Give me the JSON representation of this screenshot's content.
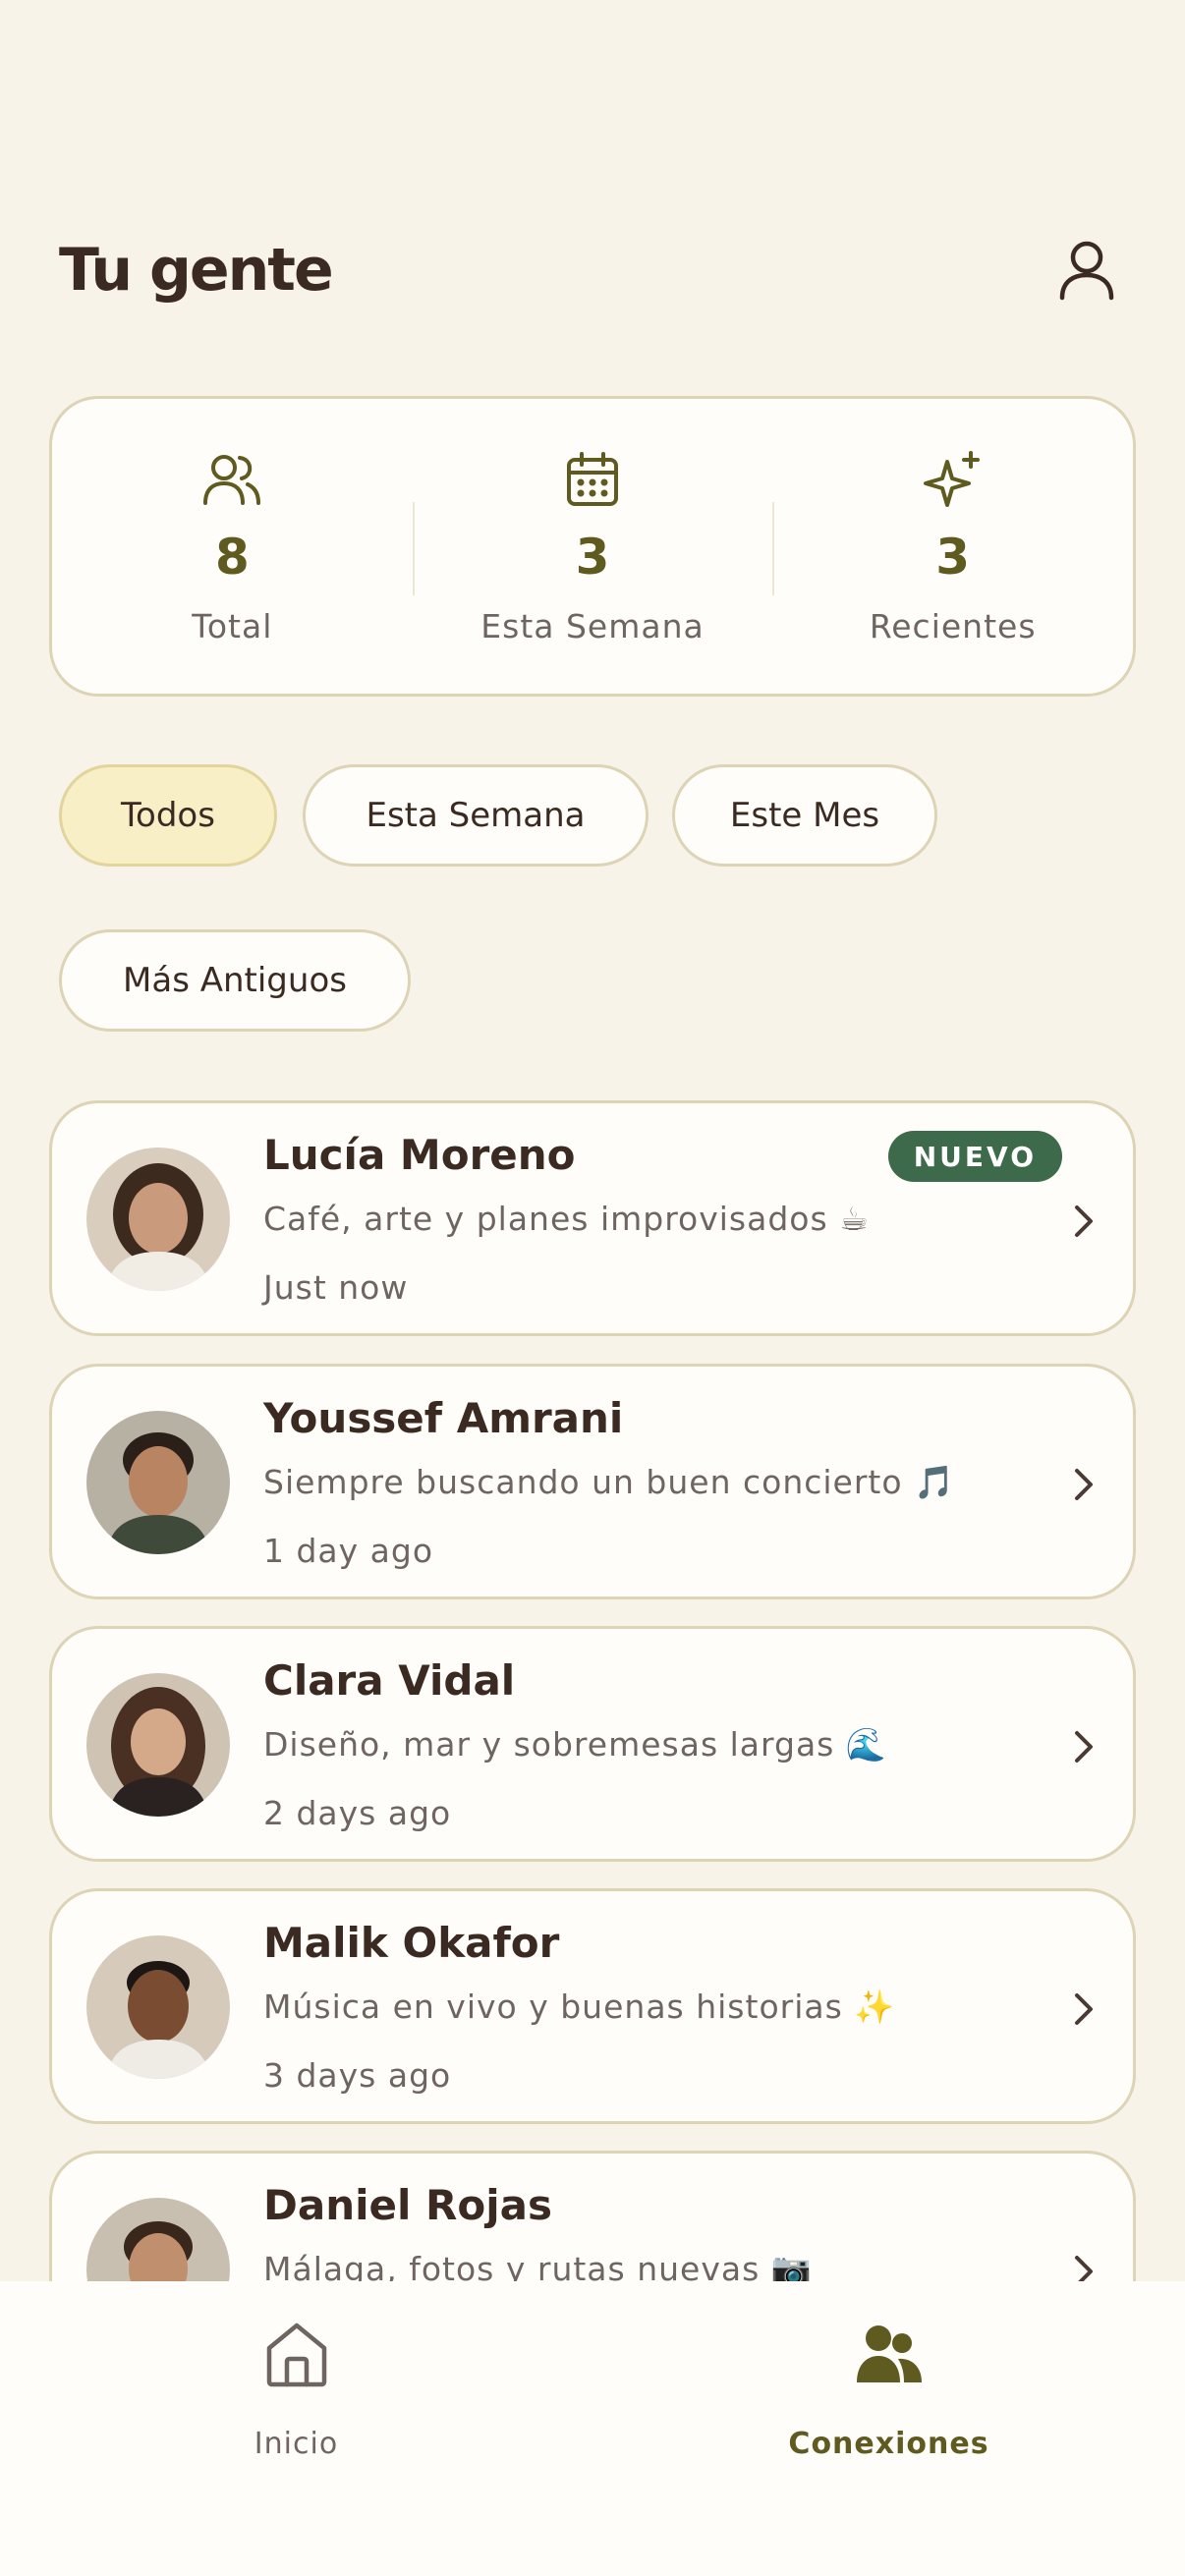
{
  "header": {
    "title": "Tu gente",
    "profile_icon": "user-icon"
  },
  "stats": [
    {
      "icon": "users-icon",
      "value": "8",
      "label": "Total"
    },
    {
      "icon": "calendar-icon",
      "value": "3",
      "label": "Esta Semana"
    },
    {
      "icon": "sparkles-icon",
      "value": "3",
      "label": "Recientes"
    }
  ],
  "filters": [
    {
      "label": "Todos",
      "active": true
    },
    {
      "label": "Esta Semana",
      "active": false
    },
    {
      "label": "Este Mes",
      "active": false
    },
    {
      "label": "Más Antiguos",
      "active": false
    }
  ],
  "people": [
    {
      "name": "Lucía Moreno",
      "bio": "Café, arte y planes improvisados ☕",
      "time": "Just now",
      "badge": "NUEVO"
    },
    {
      "name": "Youssef Amrani",
      "bio": "Siempre buscando un buen concierto 🎵",
      "time": "1 day ago"
    },
    {
      "name": "Clara Vidal",
      "bio": "Diseño, mar y sobremesas largas 🌊",
      "time": "2 days ago"
    },
    {
      "name": "Malik Okafor",
      "bio": "Música en vivo y buenas historias ✨",
      "time": "3 days ago"
    },
    {
      "name": "Daniel Rojas",
      "bio": "Málaga, fotos y rutas nuevas 📷",
      "time": ""
    }
  ],
  "nav": [
    {
      "label": "Inicio",
      "icon": "home-icon",
      "active": false
    },
    {
      "label": "Conexiones",
      "icon": "users-icon",
      "active": true
    }
  ],
  "colors": {
    "background": "#f7f3e9",
    "card": "#fffdf9",
    "accent": "#5f5a1f",
    "badge": "#3d6a4a",
    "active_chip": "#f8efc7"
  }
}
